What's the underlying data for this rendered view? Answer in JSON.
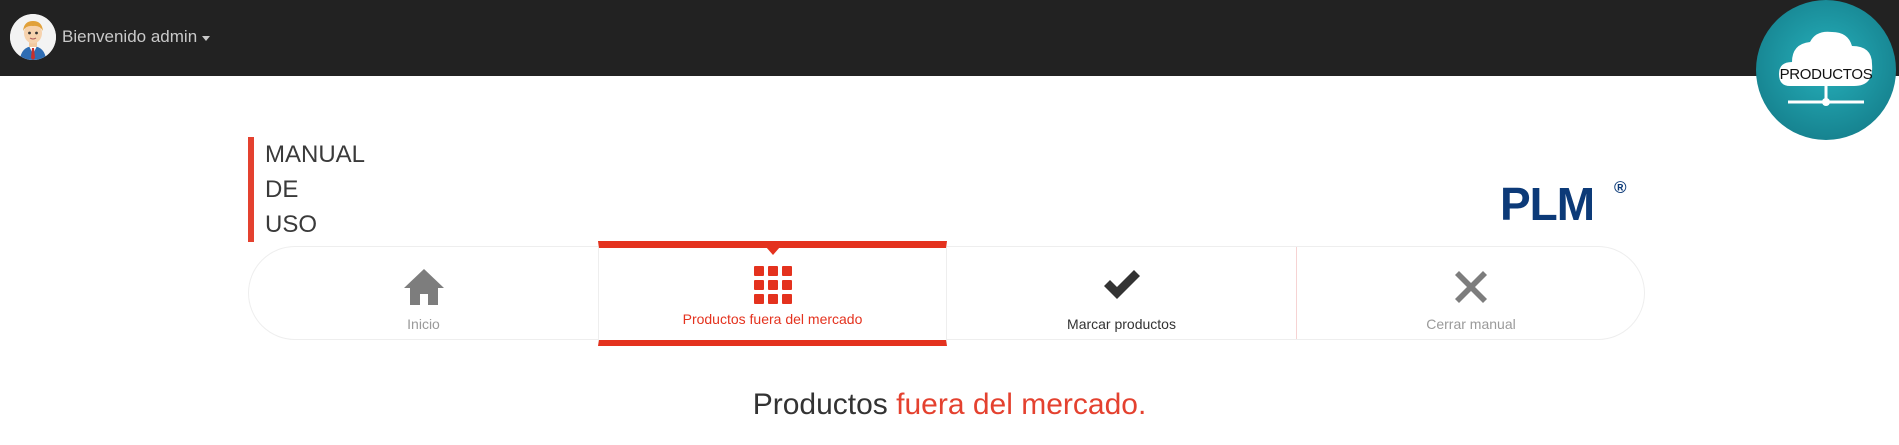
{
  "navbar": {
    "user_label": "Bienvenido admin",
    "avatar_icon": "user-avatar-icon",
    "background": "#222222"
  },
  "cloud_badge": {
    "label": "PRODUCTOS",
    "icon": "cloud-network-icon",
    "color": "#1e9aa6"
  },
  "manual_title": {
    "lines": [
      "MANUAL",
      "DE",
      "USO"
    ],
    "accent": "#e4412f"
  },
  "logo": {
    "text": "PLM",
    "mark": "®",
    "color": "#0c3a78"
  },
  "tabs": [
    {
      "label": "Inicio",
      "icon": "home-icon",
      "active": false,
      "color": "#9a9a9a"
    },
    {
      "label": "Productos fuera del mercado",
      "icon": "grid-icon",
      "active": true,
      "color": "#e4321e"
    },
    {
      "label": "Marcar productos",
      "icon": "checkmark-icon",
      "active": false,
      "color": "#333333"
    },
    {
      "label": "Cerrar manual",
      "icon": "close-icon",
      "active": false,
      "color": "#9a9a9a"
    }
  ],
  "heading": {
    "prefix": "Productos",
    "accent": "fuera del mercado."
  }
}
